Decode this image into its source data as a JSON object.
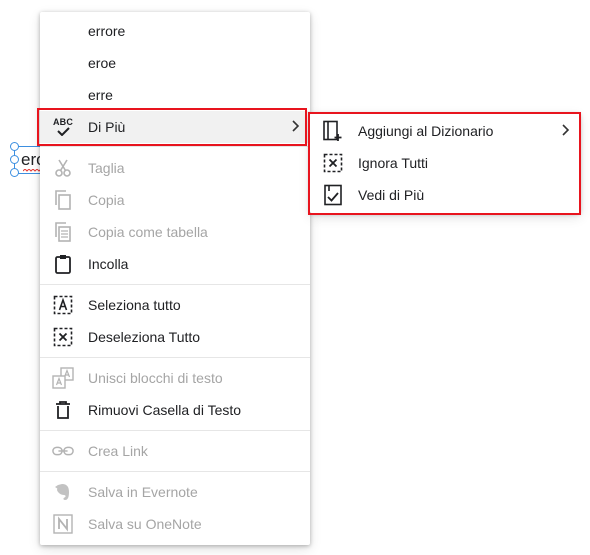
{
  "textbox": {
    "text": "ero"
  },
  "menu": {
    "suggestions": [
      "errore",
      "eroe",
      "erre"
    ],
    "more": {
      "label": "Di Più",
      "icon": "spellcheck-icon",
      "abc": "ABC"
    },
    "clipboard": [
      {
        "label": "Taglia",
        "icon": "scissors-icon",
        "enabled": false
      },
      {
        "label": "Copia",
        "icon": "copy-icon",
        "enabled": false
      },
      {
        "label": "Copia come tabella",
        "icon": "copy-table-icon",
        "enabled": false
      },
      {
        "label": "Incolla",
        "icon": "paste-icon",
        "enabled": true
      }
    ],
    "selection": [
      {
        "label": "Seleziona tutto",
        "icon": "select-all-icon",
        "enabled": true
      },
      {
        "label": "Deseleziona Tutto",
        "icon": "deselect-all-icon",
        "enabled": true
      }
    ],
    "blocks": [
      {
        "label": "Unisci blocchi di testo",
        "icon": "merge-text-blocks-icon",
        "enabled": false
      },
      {
        "label": "Rimuovi Casella di Testo",
        "icon": "trash-icon",
        "enabled": true
      }
    ],
    "link": {
      "label": "Crea Link",
      "icon": "link-icon",
      "enabled": false
    },
    "share": [
      {
        "label": "Salva in Evernote",
        "icon": "evernote-icon",
        "enabled": false
      },
      {
        "label": "Salva su OneNote",
        "icon": "onenote-icon",
        "enabled": false
      }
    ]
  },
  "submenu": {
    "items": [
      {
        "label": "Aggiungi al Dizionario",
        "icon": "add-to-dictionary-icon",
        "has_submenu": true
      },
      {
        "label": "Ignora Tutti",
        "icon": "ignore-all-icon",
        "has_submenu": false
      },
      {
        "label": "Vedi di Più",
        "icon": "see-more-icon",
        "has_submenu": false
      }
    ]
  },
  "colors": {
    "highlight_border": "#e8141e",
    "selection_handle": "#3c8fe0",
    "disabled_text": "#a5a5a5",
    "active_row": "#f1f1f1"
  }
}
